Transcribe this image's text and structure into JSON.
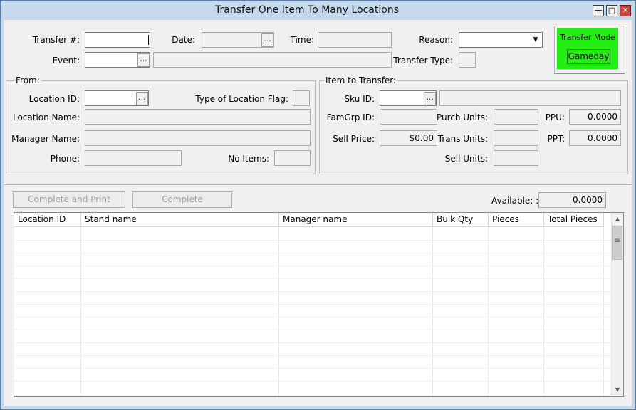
{
  "window": {
    "title": "Transfer One Item To Many Locations"
  },
  "header": {
    "transfer_num_label": "Transfer #:",
    "transfer_num_value": "",
    "date_label": "Date:",
    "time_label": "Time:",
    "reason_label": "Reason:",
    "reason_value": "",
    "event_label": "Event:",
    "transfer_type_label": "Transfer Type:",
    "transfer_mode_label": "Transfer Mode",
    "transfer_mode_value": "Gameday"
  },
  "from": {
    "legend": "From:",
    "location_id_label": "Location ID:",
    "type_flag_label": "Type of Location Flag:",
    "location_name_label": "Location Name:",
    "manager_name_label": "Manager Name:",
    "phone_label": "Phone:",
    "no_items_label": "No Items:"
  },
  "item": {
    "legend": "Item to Transfer:",
    "sku_label": "Sku ID:",
    "famgrp_label": "FamGrp ID:",
    "purch_units_label": "Purch Units:",
    "ppu_label": "PPU:",
    "ppu_value": "0.0000",
    "sell_price_label": "Sell Price:",
    "sell_price_value": "$0.00",
    "trans_units_label": "Trans Units:",
    "ppt_label": "PPT:",
    "ppt_value": "0.0000",
    "sell_units_label": "Sell Units:"
  },
  "actions": {
    "complete_print": "Complete and Print",
    "complete": "Complete",
    "available_label": "Available: :",
    "available_value": "0.0000"
  },
  "grid": {
    "columns": [
      "Location ID",
      "Stand name",
      "Manager name",
      "Bulk Qty",
      "Pieces",
      "Total Pieces"
    ]
  },
  "colors": {
    "transfer_mode_bg": "#22ee11",
    "close_button": "#c9443a"
  },
  "icons": {
    "ellipsis": "...",
    "dropdown": "▼",
    "scroll_up": "▲",
    "scroll_down": "▼",
    "grip": "≡"
  }
}
